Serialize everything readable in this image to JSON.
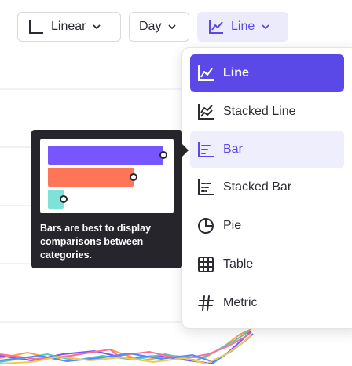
{
  "toolbar": {
    "scale_label": "Linear",
    "interval_label": "Day",
    "chart_type_label": "Line"
  },
  "chart_type_menu": {
    "items": [
      {
        "label": "Line",
        "icon": "line-chart-icon",
        "state": "selected"
      },
      {
        "label": "Stacked Line",
        "icon": "stacked-line-icon",
        "state": "normal"
      },
      {
        "label": "Bar",
        "icon": "bar-chart-icon",
        "state": "hover"
      },
      {
        "label": "Stacked Bar",
        "icon": "stacked-bar-icon",
        "state": "normal"
      },
      {
        "label": "Pie",
        "icon": "pie-chart-icon",
        "state": "normal"
      },
      {
        "label": "Table",
        "icon": "table-icon",
        "state": "normal"
      },
      {
        "label": "Metric",
        "icon": "hash-icon",
        "state": "normal"
      }
    ]
  },
  "tooltip": {
    "description": "Bars are best to display comparisons between categories.",
    "bar_colors": [
      "#7856ff",
      "#ff7557",
      "#80e1d9"
    ]
  },
  "colors": {
    "accent": "#5a49e6",
    "accent_light": "#ecebfb",
    "tooltip_bg": "#25252b"
  }
}
